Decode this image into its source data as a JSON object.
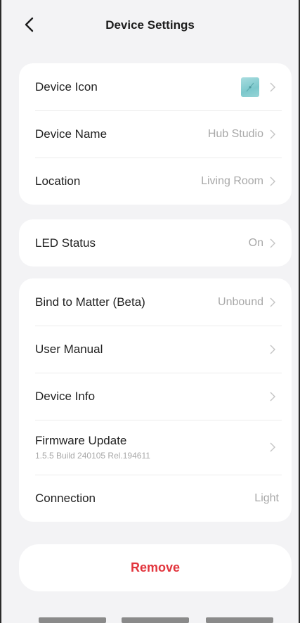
{
  "header": {
    "title": "Device Settings"
  },
  "card_general": {
    "device_icon_label": "Device Icon",
    "device_name_label": "Device Name",
    "device_name_value": "Hub Studio",
    "location_label": "Location",
    "location_value": "Living Room"
  },
  "card_led": {
    "led_label": "LED Status",
    "led_value": "On"
  },
  "card_more": {
    "matter_label": "Bind to Matter (Beta)",
    "matter_value": "Unbound",
    "manual_label": "User Manual",
    "info_label": "Device Info",
    "firmware_label": "Firmware Update",
    "firmware_version": "1.5.5 Build 240105 Rel.194611",
    "connection_label": "Connection",
    "connection_value": "Light"
  },
  "actions": {
    "remove_label": "Remove"
  },
  "colors": {
    "background": "#f3f3f5",
    "card": "#ffffff",
    "danger": "#e2353d",
    "muted_text": "#a8a8a8"
  },
  "icons": [
    "back-arrow-icon",
    "chevron-right-icon",
    "device-thumbnail-icon"
  ]
}
